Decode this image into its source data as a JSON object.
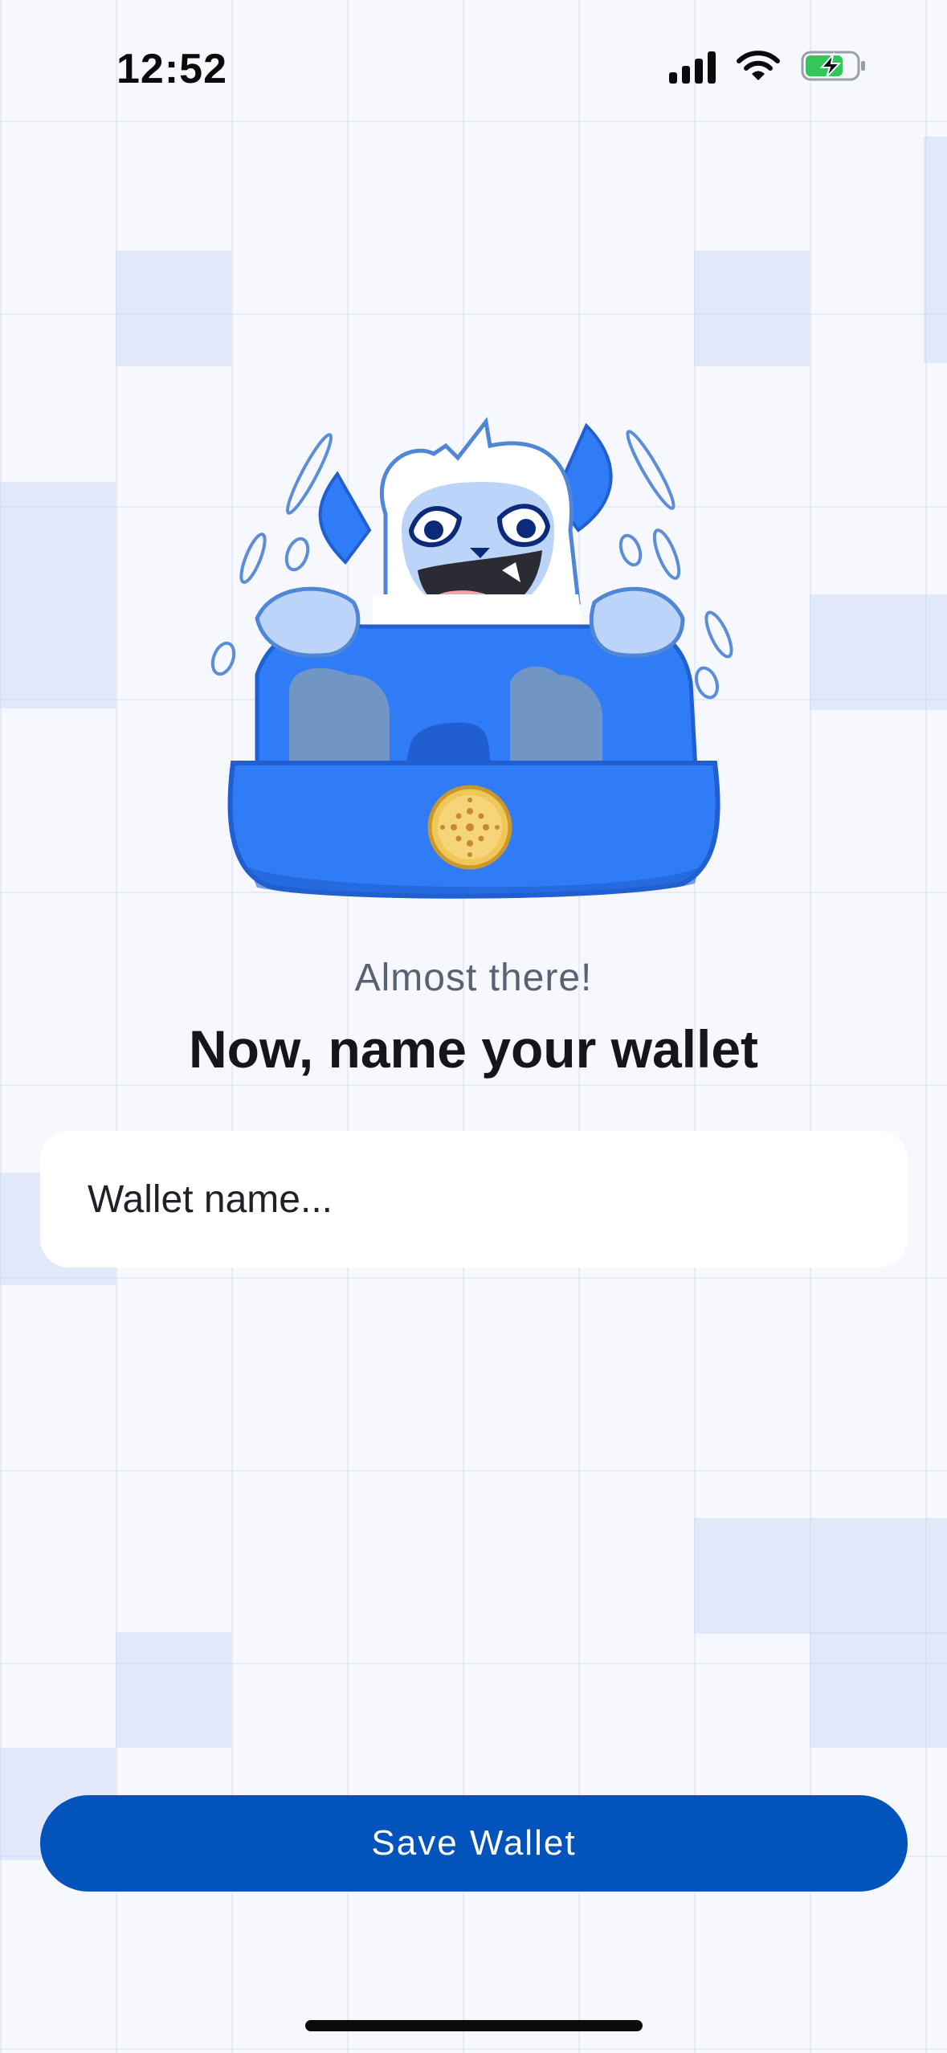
{
  "status_bar": {
    "time": "12:52"
  },
  "onboarding": {
    "subtitle": "Almost there!",
    "title": "Now, name your wallet"
  },
  "wallet_name": {
    "value": "",
    "placeholder": "Wallet name..."
  },
  "actions": {
    "save_label": "Save Wallet"
  },
  "colors": {
    "primary": "#0353bd",
    "background": "#f7f8fd",
    "mascot_blue": "#2f7cf6"
  },
  "icons": {
    "signal": "cellular-signal-icon",
    "wifi": "wifi-icon",
    "battery": "battery-charging-icon"
  }
}
